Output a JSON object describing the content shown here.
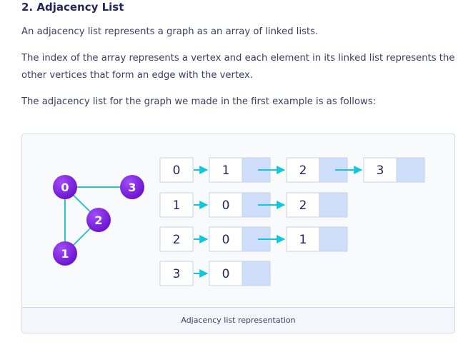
{
  "section": {
    "heading": "2. Adjacency List",
    "paragraphs": [
      "An adjacency list represents a graph as an array of linked lists.",
      "The index of the array represents a vertex and each element in its linked list represents the other vertices that form an edge with the vertex.",
      "The adjacency list for the graph we made in the first example is as follows:"
    ]
  },
  "figure": {
    "caption": "Adjacency list representation",
    "graph": {
      "nodes": [
        "0",
        "3",
        "2",
        "1"
      ],
      "edges": [
        [
          "0",
          "3"
        ],
        [
          "0",
          "2"
        ],
        [
          "0",
          "1"
        ],
        [
          "2",
          "1"
        ]
      ]
    },
    "adjacency_list": [
      {
        "vertex": "0",
        "neighbors": [
          "1",
          "2",
          "3"
        ]
      },
      {
        "vertex": "1",
        "neighbors": [
          "0",
          "2"
        ]
      },
      {
        "vertex": "2",
        "neighbors": [
          "0",
          "1"
        ]
      },
      {
        "vertex": "3",
        "neighbors": [
          "0"
        ]
      }
    ]
  },
  "colors": {
    "node_purple": "#7c1ae0",
    "edge_teal": "#2bc4c9",
    "arrow_cyan": "#10c8dc",
    "pointer_cell": "#cfdefa",
    "cell_border": "#c8d3e0"
  }
}
